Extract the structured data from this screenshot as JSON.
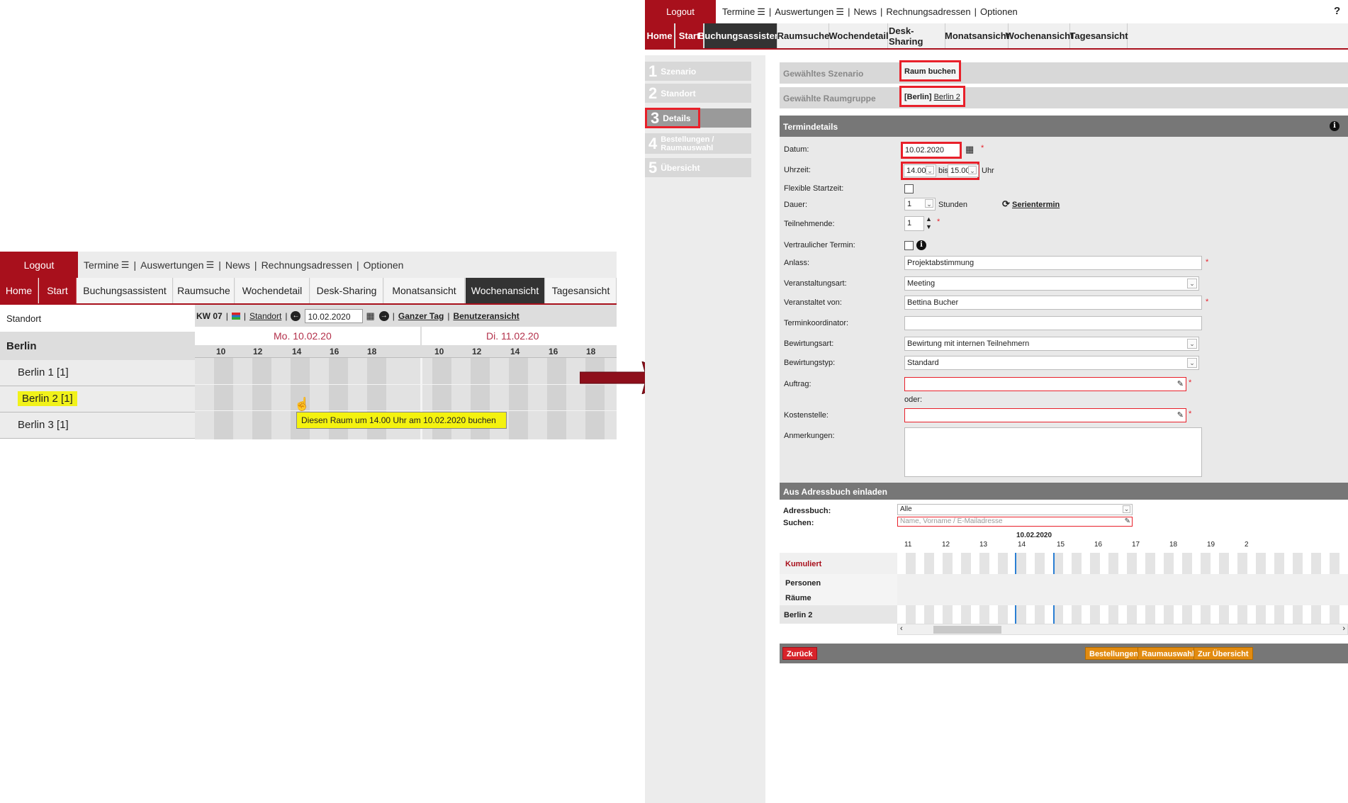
{
  "nav": {
    "logout": "Logout",
    "top_menu": [
      "Termine",
      "Auswertungen",
      "News",
      "Rechnungsadressen",
      "Optionen"
    ],
    "tabs": [
      "Home",
      "Start",
      "Buchungsassistent",
      "Raumsuche",
      "Wochendetail",
      "Desk-Sharing",
      "Monatsansicht",
      "Wochenansicht",
      "Tagesansicht"
    ]
  },
  "left": {
    "active_tab": "Wochenansicht",
    "location_label": "Standort",
    "week": "KW 07",
    "standort_link": "Standort",
    "date": "10.02.2020",
    "whole_day": "Ganzer Tag",
    "user_view": "Benutzeransicht",
    "group": "Berlin",
    "rooms": [
      "Berlin 1 [1]",
      "Berlin 2 [1]",
      "Berlin 3 [1]"
    ],
    "days": [
      "Mo. 10.02.20",
      "Di. 11.02.20"
    ],
    "hours": [
      "10",
      "12",
      "14",
      "16",
      "18"
    ],
    "tooltip": "Diesen Raum um 14.00 Uhr am 10.02.2020 buchen"
  },
  "right": {
    "active_tab": "Buchungsassistent",
    "help": "?",
    "steps": [
      {
        "num": "1",
        "label": "Szenario"
      },
      {
        "num": "2",
        "label": "Standort"
      },
      {
        "num": "3",
        "label": "Details"
      },
      {
        "num": "4",
        "label": "Bestellungen / Raumauswahl"
      },
      {
        "num": "5",
        "label": "Übersicht"
      }
    ],
    "scenario_label": "Gewähltes Szenario",
    "scenario_value": "Raum buchen",
    "roomgroup_label": "Gewählte Raumgruppe",
    "roomgroup_prefix": "[Berlin]",
    "roomgroup_link": "Berlin 2",
    "details_header": "Termindetails",
    "form": {
      "datum_label": "Datum:",
      "datum": "10.02.2020",
      "uhrzeit_label": "Uhrzeit:",
      "from": "14.00",
      "bis": "bis",
      "to": "15.00",
      "uhr": "Uhr",
      "flex_label": "Flexible Startzeit:",
      "dauer_label": "Dauer:",
      "dauer": "1",
      "stunden": "Stunden",
      "serien": "Serientermin",
      "teilnehmende_label": "Teilnehmende:",
      "teilnehmende": "1",
      "vertraulich_label": "Vertraulicher Termin:",
      "anlass_label": "Anlass:",
      "anlass": "Projektabstimmung",
      "veranstaltungsart_label": "Veranstaltungsart:",
      "veranstaltungsart": "Meeting",
      "veranstaltet_label": "Veranstaltet von:",
      "veranstaltet": "Bettina Bucher",
      "koordinator_label": "Terminkoordinator:",
      "bewirtungsart_label": "Bewirtungsart:",
      "bewirtungsart": "Bewirtung mit internen Teilnehmern",
      "bewirtungstyp_label": "Bewirtungstyp:",
      "bewirtungstyp": "Standard",
      "auftrag_label": "Auftrag:",
      "oder": "oder:",
      "kostenstelle_label": "Kostenstelle:",
      "anmerkungen_label": "Anmerkungen:"
    },
    "addressbook": {
      "header": "Aus Adressbuch einladen",
      "book_label": "Adressbuch:",
      "book_value": "Alle",
      "search_label": "Suchen:",
      "search_placeholder": "Name, Vorname / E-Mailadresse",
      "date": "10.02.2020",
      "hours": [
        "11",
        "12",
        "13",
        "14",
        "15",
        "16",
        "17",
        "18",
        "19",
        "2"
      ],
      "rows": [
        "Kumuliert",
        "Personen",
        "Räume",
        "Berlin 2"
      ]
    },
    "buttons": {
      "back": "Zurück",
      "orders": "Bestellungen",
      "room_select": "Raumauswahl",
      "overview": "Zur Übersicht"
    }
  },
  "colors": {
    "brand": "#a8101c",
    "highlight": "#e8202a",
    "accent_orange": "#e28b10"
  }
}
